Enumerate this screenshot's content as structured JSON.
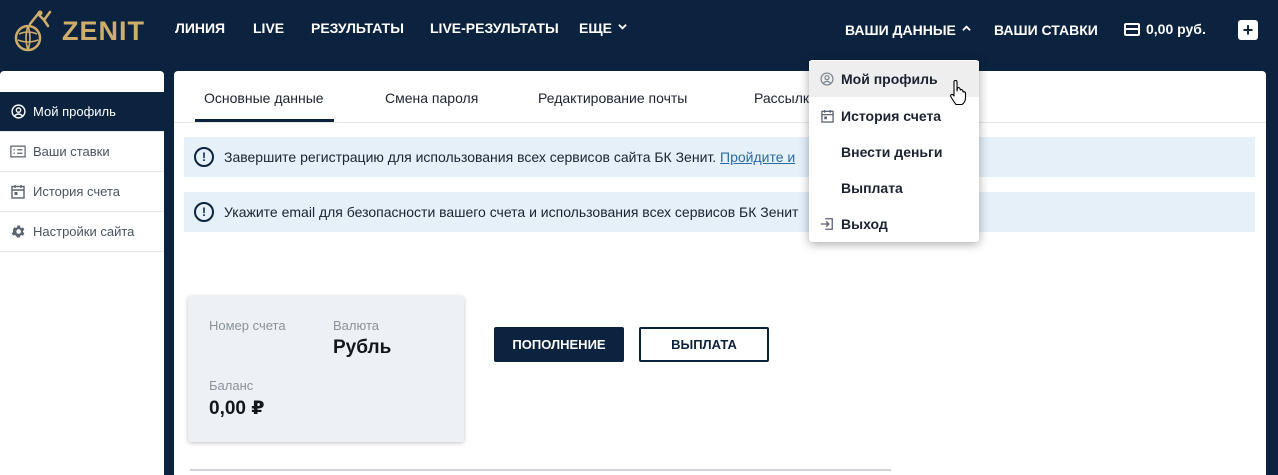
{
  "brand": {
    "name": "ZENIT",
    "gold": "#cfae6b",
    "navy": "#0c2340"
  },
  "topnav": {
    "items": [
      "ЛИНИЯ",
      "LIVE",
      "РЕЗУЛЬТАТЫ",
      "LIVE-РЕЗУЛЬТАТЫ",
      "ЕЩЕ"
    ],
    "account_label": "ВАШИ ДАННЫЕ",
    "bets_label": "ВАШИ СТАВКИ",
    "balance": "0,00 руб.",
    "plus_label": "+"
  },
  "sidebar": {
    "items": [
      {
        "label": "Мой профиль",
        "icon": "user-circle-icon",
        "active": true
      },
      {
        "label": "Ваши ставки",
        "icon": "bets-list-icon",
        "active": false
      },
      {
        "label": "История счета",
        "icon": "calendar-icon",
        "active": false
      },
      {
        "label": "Настройки сайта",
        "icon": "gear-icon",
        "active": false
      }
    ]
  },
  "tabs": [
    "Основные данные",
    "Смена пароля",
    "Редактирование почты",
    "Рассылк"
  ],
  "notices": [
    {
      "text": "Завершите регистрацию для использования всех сервисов сайта БК Зенит.",
      "link": "Пройдите и"
    },
    {
      "text": "Укажите email для безопасности вашего счета и использования всех сервисов БК Зенит",
      "link": ""
    }
  ],
  "account": {
    "number_label": "Номер счета",
    "currency_label": "Валюта",
    "currency_value": "Рубль",
    "balance_label": "Баланс",
    "balance_value": "0,00 ₽"
  },
  "actions": {
    "deposit": "ПОПОЛНЕНИЕ",
    "withdraw": "ВЫПЛАТА"
  },
  "dropdown": {
    "items": [
      {
        "label": "Мой профиль",
        "icon": "user-circle-icon"
      },
      {
        "label": "История счета",
        "icon": "calendar-icon"
      },
      {
        "label": "Внести деньги",
        "icon": ""
      },
      {
        "label": "Выплата",
        "icon": ""
      },
      {
        "label": "Выход",
        "icon": "logout-icon"
      }
    ]
  }
}
